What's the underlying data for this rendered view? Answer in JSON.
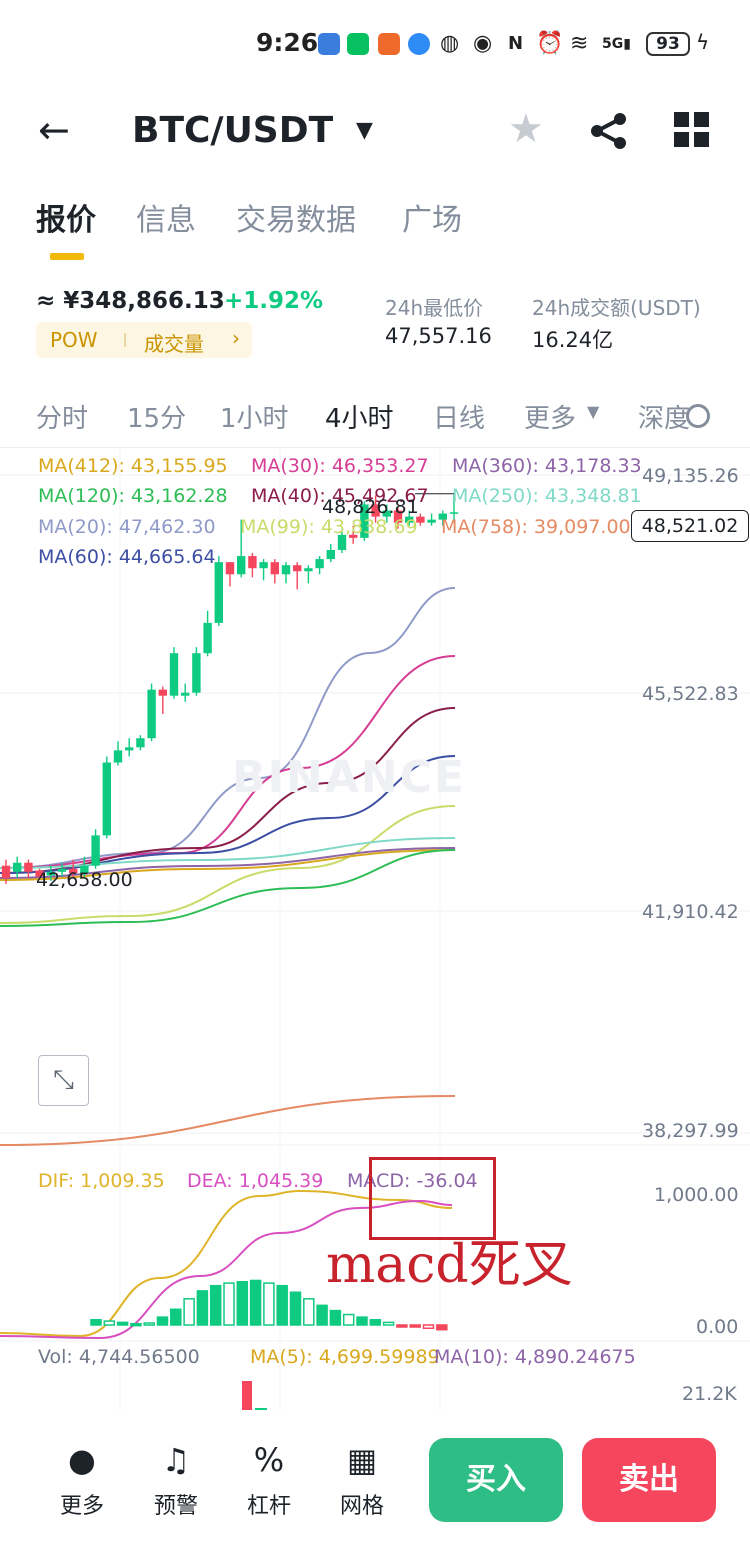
{
  "status_bar": {
    "time": "9:26",
    "signal": "5G",
    "battery": "93"
  },
  "header": {
    "title": "BTC/USDT"
  },
  "main_tabs": [
    "报价",
    "信息",
    "交易数据",
    "广场"
  ],
  "price": {
    "approx": "≈ ¥348,866.13",
    "change": "+1.92%",
    "pow_label": "POW",
    "volume_tag": "成交量"
  },
  "stats": [
    {
      "label": "24h最低价",
      "value": "47,557.16"
    },
    {
      "label": "24h成交额(USDT)",
      "value": "16.24亿"
    }
  ],
  "intervals": [
    "分时",
    "15分",
    "1小时",
    "4小时",
    "日线",
    "更多",
    "深度"
  ],
  "active_interval": "4小时",
  "ma_legend": [
    {
      "text": "MA(412): 43,155.95",
      "color": "#d9a81e"
    },
    {
      "text": "MA(30): 46,353.27",
      "color": "#d63d95"
    },
    {
      "text": "MA(360): 43,178.33",
      "color": "#8d64a8"
    },
    {
      "text": "MA(120): 43,162.28",
      "color": "#2ebd55"
    },
    {
      "text": "MA(40): 45,492.67",
      "color": "#8b1e4a"
    },
    {
      "text": "MA(250): 43,348.81",
      "color": "#7fd9c6"
    },
    {
      "text": "MA(20): 47,462.30",
      "color": "#8f9ac9"
    },
    {
      "text": "MA(99): 43,838.69",
      "color": "#c9dc6a"
    },
    {
      "text": "MA(758): 39,097.00",
      "color": "#e58a63"
    },
    {
      "text": "MA(60): 44,665.64",
      "color": "#3c4fa3"
    }
  ],
  "price_axis": [
    "49,135.26",
    "45,522.83",
    "41,910.42",
    "38,297.99"
  ],
  "current_price": "48,521.02",
  "high_marker": "48,826.81",
  "low_marker": "42,658.00",
  "watermark": "BINANCE",
  "macd": {
    "dif": "DIF: 1,009.35",
    "dea": "DEA: 1,045.39",
    "macd": "MACD: -36.04",
    "dif_color": "#e0b429",
    "dea_color": "#d84fc1",
    "macd_color": "#8d64a8",
    "axis": [
      "1,000.00",
      "0.00"
    ]
  },
  "annotation": "macd死叉",
  "volume": {
    "vol": "Vol: 4,744.56500",
    "ma5": "MA(5): 4,699.59989",
    "ma10": "MA(10): 4,890.24675",
    "axis": "21.2K"
  },
  "bottom_bar": {
    "more": "更多",
    "alert": "预警",
    "leverage": "杠杆",
    "grid": "网格",
    "buy": "买入",
    "sell": "卖出"
  },
  "colors": {
    "up": "#0ecb81",
    "down": "#f6465d",
    "brand": "#f0b90b"
  },
  "chart_data": {
    "type": "candlestick",
    "candles": [
      {
        "o": 42700,
        "c": 42500,
        "h": 42800,
        "l": 42400
      },
      {
        "o": 42600,
        "c": 42750,
        "h": 42850,
        "l": 42500
      },
      {
        "o": 42750,
        "c": 42600,
        "h": 42800,
        "l": 42500
      },
      {
        "o": 42620,
        "c": 42520,
        "h": 42650,
        "l": 42480
      },
      {
        "o": 42540,
        "c": 42600,
        "h": 42700,
        "l": 42450
      },
      {
        "o": 42600,
        "c": 42650,
        "h": 42750,
        "l": 42520
      },
      {
        "o": 42650,
        "c": 42580,
        "h": 42800,
        "l": 42500
      },
      {
        "o": 42580,
        "c": 42700,
        "h": 42850,
        "l": 42520
      },
      {
        "o": 42700,
        "c": 43200,
        "h": 43300,
        "l": 42650
      },
      {
        "o": 43200,
        "c": 44400,
        "h": 44500,
        "l": 43150
      },
      {
        "o": 44400,
        "c": 44600,
        "h": 44750,
        "l": 44350
      },
      {
        "o": 44600,
        "c": 44650,
        "h": 44800,
        "l": 44500
      },
      {
        "o": 44650,
        "c": 44800,
        "h": 44850,
        "l": 44600
      },
      {
        "o": 44800,
        "c": 45600,
        "h": 45700,
        "l": 44750
      },
      {
        "o": 45600,
        "c": 45500,
        "h": 45650,
        "l": 45200
      },
      {
        "o": 45500,
        "c": 46200,
        "h": 46300,
        "l": 45450
      },
      {
        "o": 45500,
        "c": 45550,
        "h": 45700,
        "l": 45400
      },
      {
        "o": 45550,
        "c": 46200,
        "h": 46300,
        "l": 45500
      },
      {
        "o": 46200,
        "c": 46700,
        "h": 46900,
        "l": 46150
      },
      {
        "o": 46700,
        "c": 47700,
        "h": 47800,
        "l": 46650
      },
      {
        "o": 47700,
        "c": 47500,
        "h": 47700,
        "l": 47300
      },
      {
        "o": 47500,
        "c": 47800,
        "h": 48400,
        "l": 47450
      },
      {
        "o": 47800,
        "c": 47600,
        "h": 47850,
        "l": 47450
      },
      {
        "o": 47600,
        "c": 47700,
        "h": 47750,
        "l": 47400
      },
      {
        "o": 47700,
        "c": 47500,
        "h": 47750,
        "l": 47350
      },
      {
        "o": 47500,
        "c": 47650,
        "h": 47700,
        "l": 47350
      },
      {
        "o": 47650,
        "c": 47550,
        "h": 47700,
        "l": 47250
      },
      {
        "o": 47550,
        "c": 47600,
        "h": 47650,
        "l": 47350
      },
      {
        "o": 47600,
        "c": 47750,
        "h": 47800,
        "l": 47500
      },
      {
        "o": 47750,
        "c": 47900,
        "h": 48000,
        "l": 47700
      },
      {
        "o": 47900,
        "c": 48150,
        "h": 48200,
        "l": 47850
      },
      {
        "o": 48150,
        "c": 48100,
        "h": 48300,
        "l": 48000
      },
      {
        "o": 48100,
        "c": 48650,
        "h": 48700,
        "l": 48050
      },
      {
        "o": 48650,
        "c": 48450,
        "h": 48800,
        "l": 48350
      },
      {
        "o": 48450,
        "c": 48550,
        "h": 48650,
        "l": 48350
      },
      {
        "o": 48550,
        "c": 48350,
        "h": 48600,
        "l": 48250
      },
      {
        "o": 48350,
        "c": 48450,
        "h": 48550,
        "l": 48300
      },
      {
        "o": 48450,
        "c": 48350,
        "h": 48500,
        "l": 48300
      },
      {
        "o": 48350,
        "c": 48400,
        "h": 48500,
        "l": 48300
      },
      {
        "o": 48400,
        "c": 48500,
        "h": 48550,
        "l": 48300
      },
      {
        "o": 48500,
        "c": 48521,
        "h": 48826,
        "l": 48350
      }
    ],
    "ylim": [
      38297.99,
      49135.26
    ],
    "macd_hist": [
      40,
      30,
      20,
      10,
      15,
      60,
      120,
      200,
      260,
      300,
      320,
      330,
      340,
      320,
      300,
      250,
      200,
      150,
      110,
      80,
      60,
      40,
      20,
      -5,
      -15,
      -25,
      -36
    ],
    "macd_ylim": [
      -60,
      1150
    ],
    "volume_bars": [
      21200
    ],
    "volume_ylim": [
      0,
      21200
    ]
  }
}
